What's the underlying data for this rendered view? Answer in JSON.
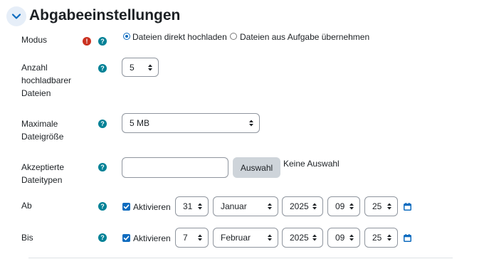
{
  "section": {
    "title": "Abgabeeinstellungen"
  },
  "fields": {
    "modus": {
      "label": "Modus",
      "options": [
        "Dateien direkt hochladen",
        "Dateien aus Aufgabe übernehmen"
      ],
      "selected": "Dateien direkt hochladen"
    },
    "anzahl": {
      "label_lines": [
        "Anzahl",
        "hochladbarer",
        "Dateien"
      ],
      "value": "5"
    },
    "max_size": {
      "label_lines": [
        "Maximale",
        "Dateigröße"
      ],
      "value": "5 MB"
    },
    "filetypes": {
      "label_lines": [
        "Akzeptierte",
        "Dateitypen"
      ],
      "value": "",
      "button_label": "Auswahl",
      "status_text": "Keine Auswahl"
    },
    "ab": {
      "label": "Ab",
      "enable_label": "Aktivieren",
      "enabled": true,
      "day": "31",
      "month": "Januar",
      "year": "2025",
      "hour": "09",
      "minute": "25"
    },
    "bis": {
      "label": "Bis",
      "enable_label": "Aktivieren",
      "enabled": true,
      "day": "7",
      "month": "Februar",
      "year": "2025",
      "hour": "09",
      "minute": "25"
    }
  },
  "icons": {
    "help_symbol": "?",
    "required_symbol": "!"
  },
  "colors": {
    "primary": "#0f6cbf",
    "help": "#008196",
    "required": "#ca3120",
    "secondary_button": "#ced4da"
  }
}
